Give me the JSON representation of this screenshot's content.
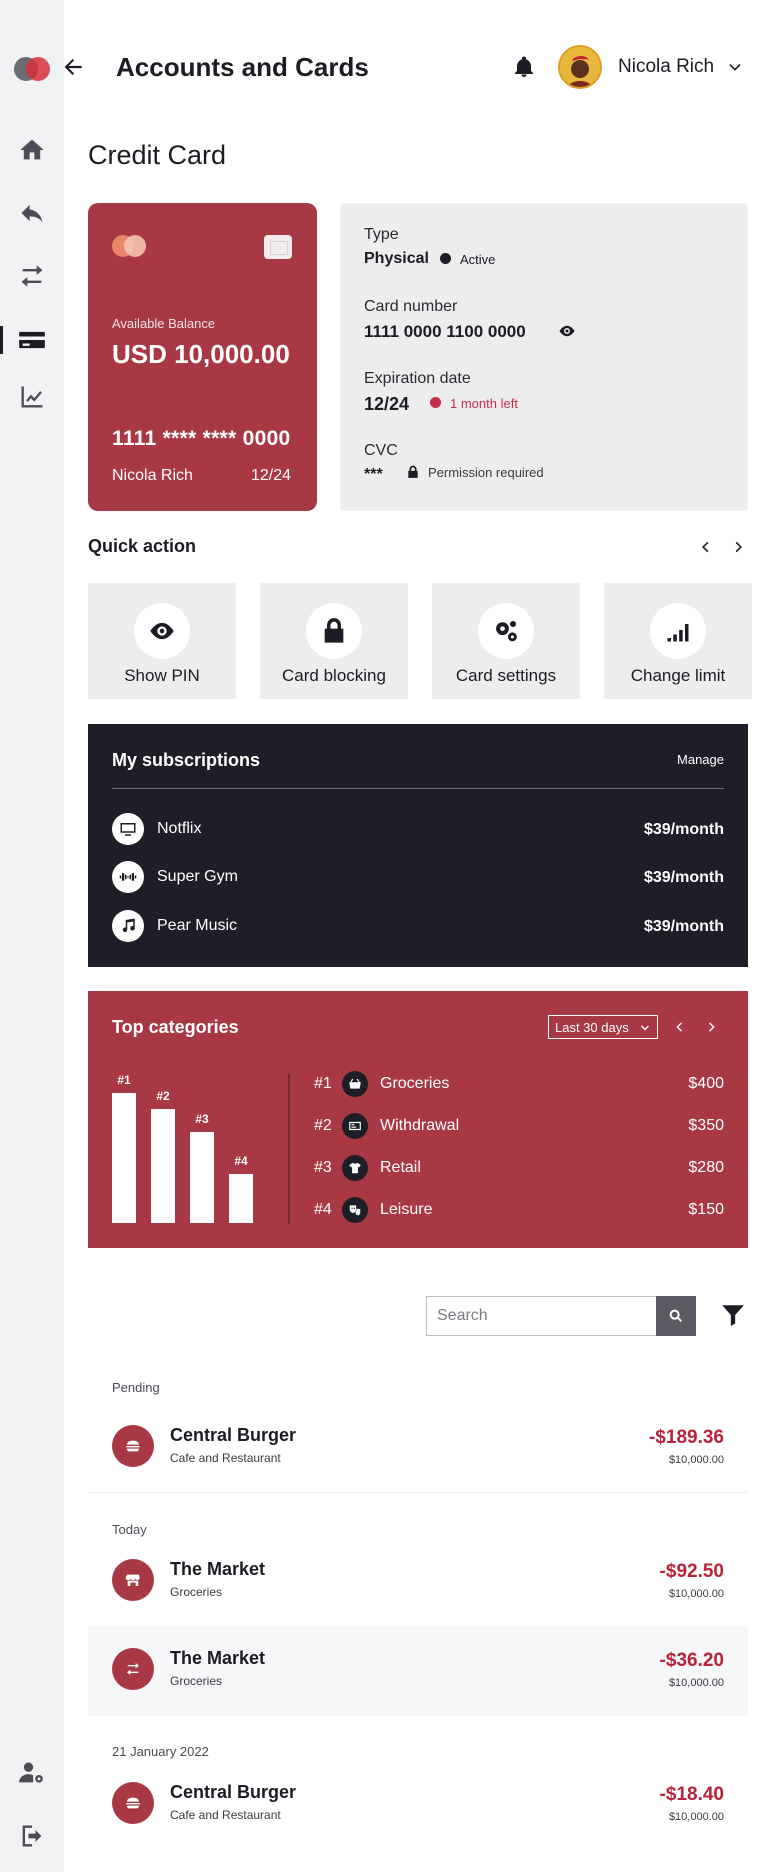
{
  "header": {
    "title": "Accounts and Cards",
    "user_name": "Nicola Rich"
  },
  "sidebar": {
    "items": [
      {
        "name": "home",
        "icon": "home-icon"
      },
      {
        "name": "reply",
        "icon": "reply-icon"
      },
      {
        "name": "transfer",
        "icon": "transfer-icon"
      },
      {
        "name": "cards",
        "icon": "credit-card-icon",
        "active": true
      },
      {
        "name": "analytics",
        "icon": "chart-icon"
      }
    ],
    "bottom": [
      {
        "name": "user-settings",
        "icon": "user-gear-icon"
      },
      {
        "name": "logout",
        "icon": "logout-icon"
      }
    ]
  },
  "section": {
    "title": "Credit Card"
  },
  "card": {
    "available_label": "Available Balance",
    "balance": "USD 10,000.00",
    "number": "1111 **** **** 0000",
    "holder": "Nicola Rich",
    "expiry": "12/24",
    "color": "#a83843"
  },
  "card_info": {
    "type_label": "Type",
    "type_value": "Physical",
    "status": "Active",
    "number_label": "Card number",
    "number_value": "1111 0000 1100 0000",
    "exp_label": "Expiration date",
    "exp_value": "12/24",
    "exp_note": "1 month left",
    "cvc_label": "CVC",
    "cvc_value": "***",
    "cvc_note": "Permission required"
  },
  "quick_action": {
    "title": "Quick action",
    "tiles": [
      {
        "label": "Show PIN",
        "icon": "eye-icon"
      },
      {
        "label": "Card blocking",
        "icon": "lock-icon"
      },
      {
        "label": "Card settings",
        "icon": "gears-icon"
      },
      {
        "label": "Change limit",
        "icon": "signal-icon"
      }
    ]
  },
  "subscriptions": {
    "title": "My subscriptions",
    "manage": "Manage",
    "items": [
      {
        "name": "Notflix",
        "price": "$39/month",
        "icon": "monitor-icon"
      },
      {
        "name": "Super Gym",
        "price": "$39/month",
        "icon": "dumbbell-icon"
      },
      {
        "name": "Pear Music",
        "price": "$39/month",
        "icon": "music-icon"
      }
    ]
  },
  "top_categories": {
    "title": "Top categories",
    "period": "Last 30 days",
    "bars": [
      {
        "label": "#1",
        "value": 400
      },
      {
        "label": "#2",
        "value": 350
      },
      {
        "label": "#3",
        "value": 280
      },
      {
        "label": "#4",
        "value": 150
      }
    ],
    "items": [
      {
        "rank": "#1",
        "name": "Groceries",
        "amount": "$400",
        "icon": "basket-icon"
      },
      {
        "rank": "#2",
        "name": "Withdrawal",
        "amount": "$350",
        "icon": "cash-icon"
      },
      {
        "rank": "#3",
        "name": "Retail",
        "amount": "$280",
        "icon": "shirt-icon"
      },
      {
        "rank": "#4",
        "name": "Leisure",
        "amount": "$150",
        "icon": "masks-icon"
      }
    ]
  },
  "search": {
    "placeholder": "Search"
  },
  "transactions": {
    "groups": [
      {
        "label": "Pending",
        "items": [
          {
            "name": "Central Burger",
            "category": "Cafe and Restaurant",
            "amount": "-$189.36",
            "balance": "$10,000.00",
            "icon": "burger-icon"
          }
        ]
      },
      {
        "label": "Today",
        "items": [
          {
            "name": "The Market",
            "category": "Groceries",
            "amount": "-$92.50",
            "balance": "$10,000.00",
            "icon": "store-icon"
          },
          {
            "name": "The Market",
            "category": "Groceries",
            "amount": "-$36.20",
            "balance": "$10,000.00",
            "icon": "transfer-icon"
          }
        ]
      },
      {
        "label": "21 January 2022",
        "items": [
          {
            "name": "Central Burger",
            "category": "Cafe and Restaurant",
            "amount": "-$18.40",
            "balance": "$10,000.00",
            "icon": "burger-icon"
          }
        ]
      }
    ]
  }
}
